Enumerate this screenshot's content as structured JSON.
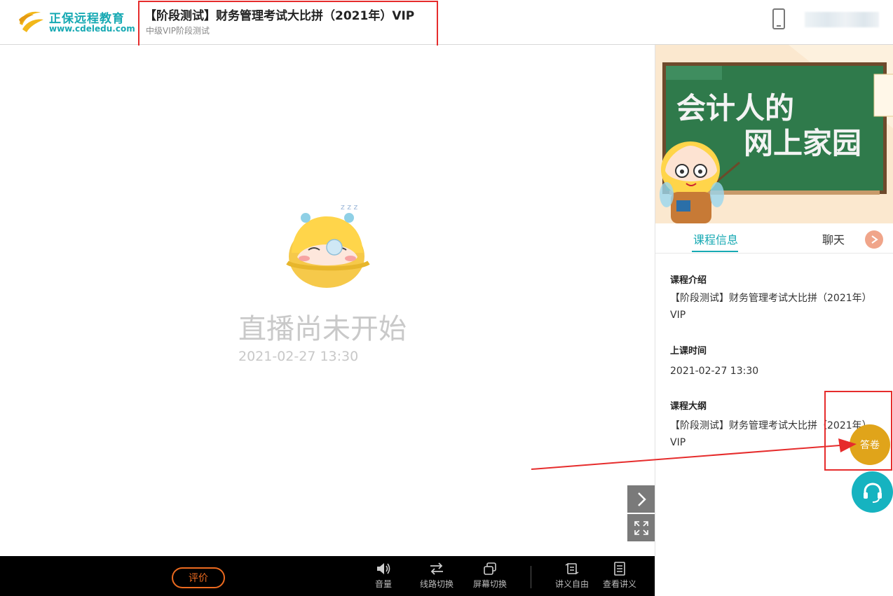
{
  "header": {
    "logo_name": "正保远程教育",
    "logo_url": "www.cdeledu.com",
    "course_title": "【阶段测试】财务管理考试大比拼（2021年）VIP",
    "course_subtitle": "中级VIP阶段测试"
  },
  "stage": {
    "status_text": "直播尚未开始",
    "start_time": "2021-02-27 13:30",
    "sleep_text": "z z z"
  },
  "bottombar": {
    "rate_label": "评价",
    "tools": [
      {
        "label": "音量",
        "icon": "volume-icon"
      },
      {
        "label": "线路切换",
        "icon": "swap-icon"
      },
      {
        "label": "屏幕切换",
        "icon": "screen-switch-icon"
      },
      {
        "label": "讲义自由",
        "icon": "handout-free-icon"
      },
      {
        "label": "查看讲义",
        "icon": "view-handout-icon"
      }
    ]
  },
  "banner": {
    "line1": "会计人的",
    "line2": "网上家园"
  },
  "tabs": {
    "info": "课程信息",
    "chat": "聊天"
  },
  "course_info": {
    "intro_heading": "课程介绍",
    "intro_text": "【阶段测试】财务管理考试大比拼（2021年）VIP",
    "time_heading": "上课时间",
    "time_text": "2021-02-27 13:30",
    "outline_heading": "课程大纲",
    "outline_text": "【阶段测试】财务管理考试大比拼（2021年）VIP"
  },
  "floating": {
    "answer_label": "答卷"
  },
  "colors": {
    "brand": "#17a9b3",
    "highlight_red": "#e62c2c",
    "answer_gold": "#e0a41a",
    "rate_orange": "#ec6a1f"
  }
}
